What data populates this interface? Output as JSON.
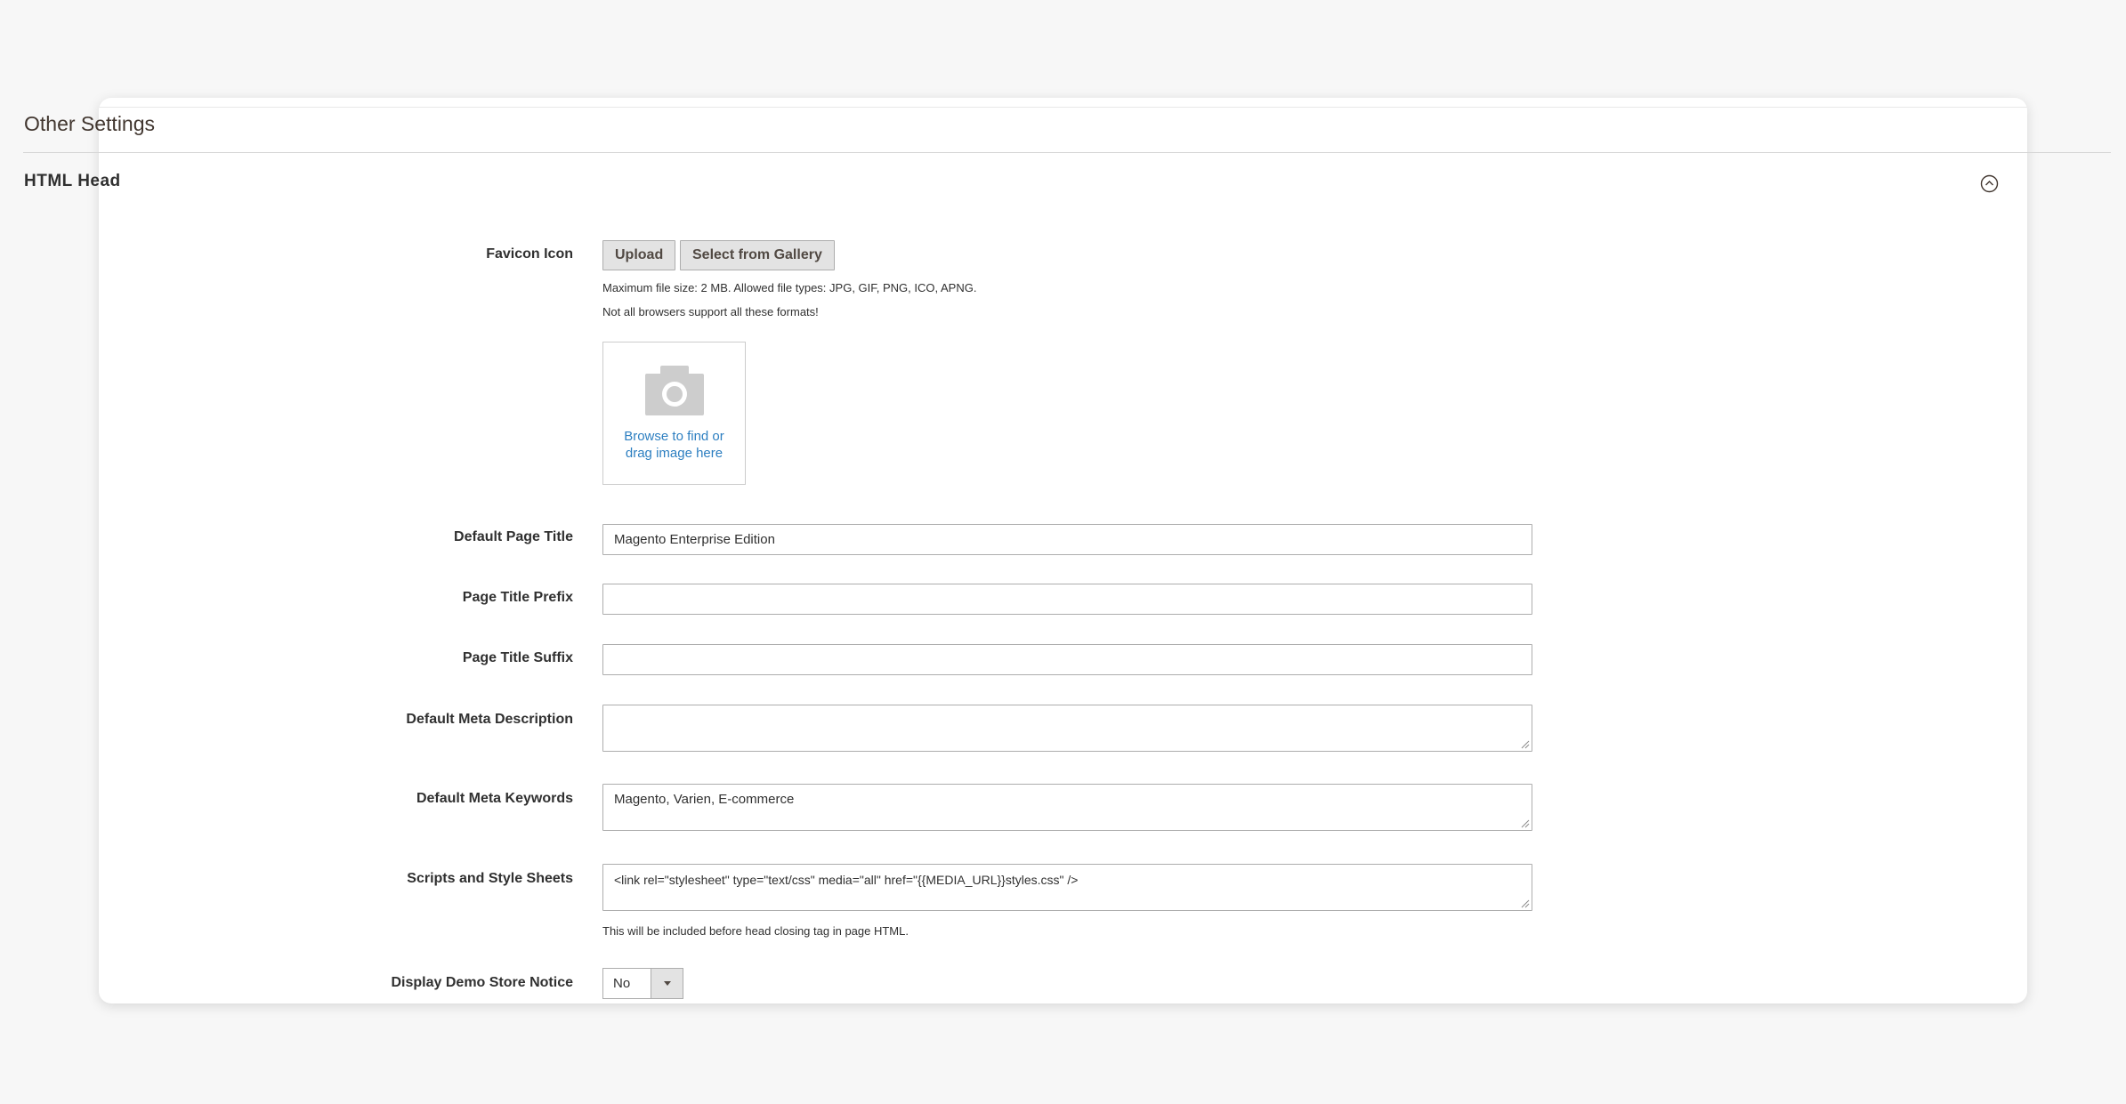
{
  "section": {
    "title": "Other Settings"
  },
  "group": {
    "title": "HTML Head",
    "collapse_icon": "collapse-circle-icon"
  },
  "favicon": {
    "label": "Favicon Icon",
    "upload_label": "Upload",
    "gallery_label": "Select from Gallery",
    "note_size": "Maximum file size: 2 MB. Allowed file types: JPG, GIF, PNG, ICO, APNG.",
    "note_browsers": "Not all browsers support all these formats!",
    "dropzone_icon": "camera-icon",
    "dropzone_text": "Browse to find or drag image here"
  },
  "fields": {
    "default_page_title": {
      "label": "Default Page Title",
      "value": "Magento Enterprise Edition"
    },
    "page_title_prefix": {
      "label": "Page Title Prefix",
      "value": ""
    },
    "page_title_suffix": {
      "label": "Page Title Suffix",
      "value": ""
    },
    "default_meta_description": {
      "label": "Default Meta Description",
      "value": ""
    },
    "default_meta_keywords": {
      "label": "Default Meta Keywords",
      "value": "Magento, Varien, E-commerce"
    },
    "scripts_and_style_sheets": {
      "label": "Scripts and Style Sheets",
      "value": "<link  rel=\"stylesheet\" type=\"text/css\"  media=\"all\" href=\"{{MEDIA_URL}}styles.css\" />",
      "note": "This will be included before head closing tag in page HTML."
    },
    "display_demo_store_notice": {
      "label": "Display Demo Store Notice",
      "value": "No"
    }
  },
  "colors": {
    "link": "#2d7fc1",
    "button_bg": "#e3e3e3",
    "border": "#adadad"
  }
}
